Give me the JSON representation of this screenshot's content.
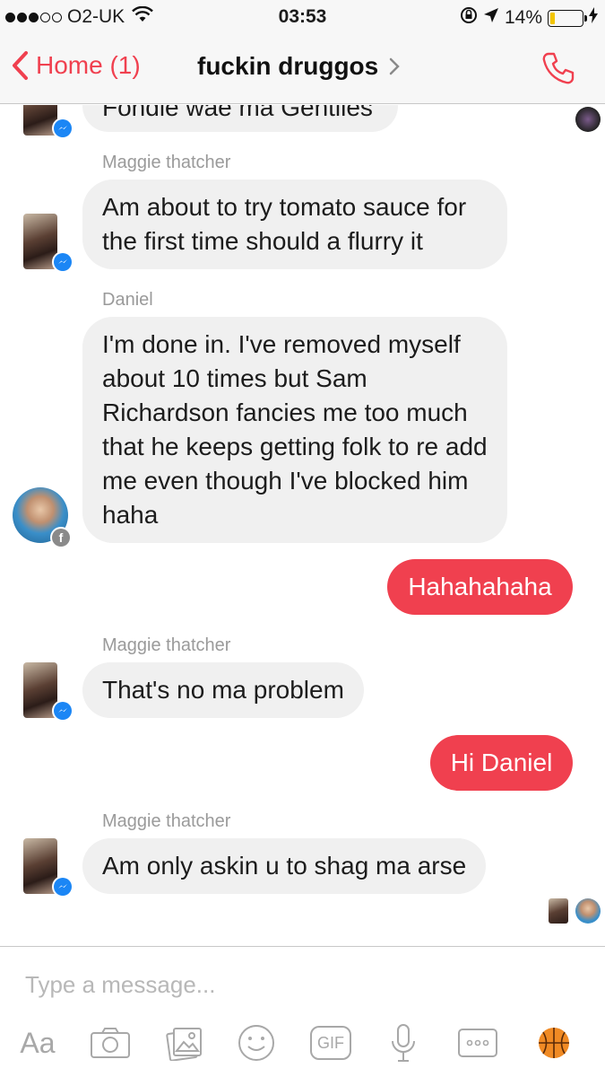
{
  "status_bar": {
    "carrier": "O2-UK",
    "time": "03:53",
    "battery_percent": "14%",
    "battery_level": 0.14,
    "signal_bars": 3
  },
  "nav": {
    "back_label": "Home (1)",
    "title": "fuckin druggos",
    "accent_color": "#f0404f"
  },
  "messages": [
    {
      "sender": "",
      "text": "Fondle wae ma Gentiles",
      "direction": "in"
    },
    {
      "sender": "Maggie thatcher",
      "text": "Am about to try tomato sauce for the first time should a flurry it",
      "direction": "in"
    },
    {
      "sender": "Daniel",
      "text": "I'm done in. I've removed myself about 10 times but Sam Richardson fancies me too much that he keeps getting folk to re add me even though I've blocked him haha",
      "direction": "in"
    },
    {
      "sender": "",
      "text": "Hahahahaha",
      "direction": "out"
    },
    {
      "sender": "Maggie thatcher",
      "text": "That's no ma problem",
      "direction": "in"
    },
    {
      "sender": "",
      "text": "Hi Daniel",
      "direction": "out"
    },
    {
      "sender": "Maggie thatcher",
      "text": "Am only askin u to shag ma arse",
      "direction": "in"
    }
  ],
  "composer": {
    "placeholder": "Type a message...",
    "text_tool": "Aa",
    "gif_tool": "GIF",
    "tools": [
      "text-icon",
      "camera-icon",
      "gallery-icon",
      "emoji-icon",
      "gif-icon",
      "microphone-icon",
      "more-icon",
      "basketball-icon"
    ]
  }
}
